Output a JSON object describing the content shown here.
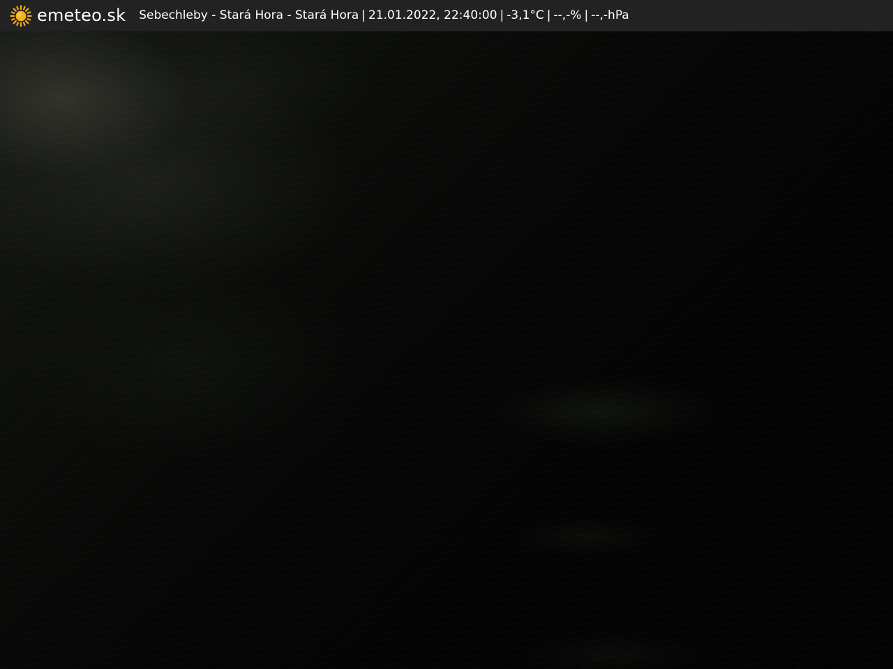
{
  "header": {
    "brand": "emeteo.sk",
    "location": "Sebechleby - Stará Hora - Stará Hora",
    "datetime": "21.01.2022, 22:40:00",
    "temperature": "-3,1°C",
    "humidity": "--,-%",
    "pressure": "--,-hPa",
    "separator": "|",
    "icon": "sun-icon",
    "background_color": "#222222",
    "icon_color": "#f5b21a",
    "text_color": "#ffffff"
  },
  "camera": {
    "scene": "night-webcam-image"
  }
}
